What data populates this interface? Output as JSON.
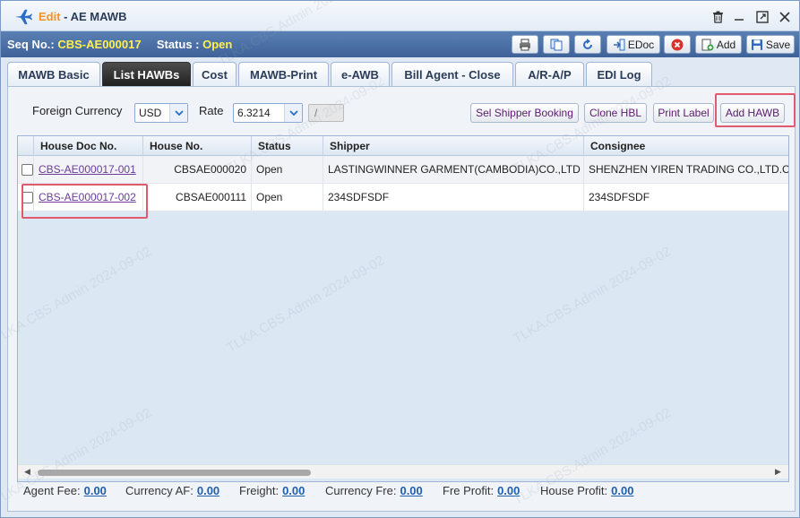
{
  "window": {
    "title_prefix": "Edit",
    "title_sep": " - ",
    "title": "AE MAWB",
    "controls": {
      "delete_icon": "trash-icon",
      "minimize_icon": "minimize-icon",
      "maximize_icon": "maximize-icon",
      "close_icon": "close-icon"
    }
  },
  "seqbar": {
    "seq_label": "Seq No.:",
    "seq_value": "CBS-AE000017",
    "status_label": "Status :",
    "status_value": "Open",
    "buttons": {
      "edoc": "EDoc",
      "add": "Add",
      "save": "Save"
    }
  },
  "tabs": [
    "MAWB Basic",
    "List HAWBs",
    "Cost",
    "MAWB-Print",
    "e-AWB",
    "Bill Agent - Close",
    "A/R-A/P",
    "EDI Log"
  ],
  "active_tab": "List HAWBs",
  "filters": {
    "currency_label": "Foreign Currency",
    "currency_value": "USD",
    "rate_label": "Rate",
    "rate_value": "6.3214",
    "rate_extra": "/"
  },
  "actions": {
    "sel_shipper": "Sel Shipper Booking",
    "clone_hbl": "Clone HBL",
    "print_label": "Print Label",
    "add_hawb": "Add HAWB"
  },
  "grid": {
    "columns": [
      "House Doc No.",
      "House No.",
      "Status",
      "Shipper",
      "Consignee"
    ],
    "rows": [
      {
        "doc_no": "CBS-AE000017-001",
        "house_no": "CBSAE000020",
        "status": "Open",
        "shipper": "LASTINGWINNER GARMENT(CAMBODIA)CO.,LTD",
        "consignee": "SHENZHEN YIREN TRADING CO.,LTD.C"
      },
      {
        "doc_no": "CBS-AE000017-002",
        "house_no": "CBSAE000111",
        "status": "Open",
        "shipper": "234SDFSDF",
        "consignee": "234SDFSDF"
      }
    ]
  },
  "footer": {
    "agent_fee_label": "Agent Fee:",
    "agent_fee": "0.00",
    "currency_af_label": "Currency AF:",
    "currency_af": "0.00",
    "freight_label": "Freight:",
    "freight": "0.00",
    "currency_fre_label": "Currency Fre:",
    "currency_fre": "0.00",
    "fre_profit_label": "Fre Profit:",
    "fre_profit": "0.00",
    "house_profit_label": "House Profit:",
    "house_profit": "0.00"
  },
  "watermark": "TLKA.CBS.Admin 2024-09-02",
  "colors": {
    "accent_orange": "#f7931e",
    "seq_yellow": "#fff14d",
    "header_blue": "#3f6399",
    "highlight_red": "#e05a6e",
    "link_purple": "#6b3c98"
  }
}
